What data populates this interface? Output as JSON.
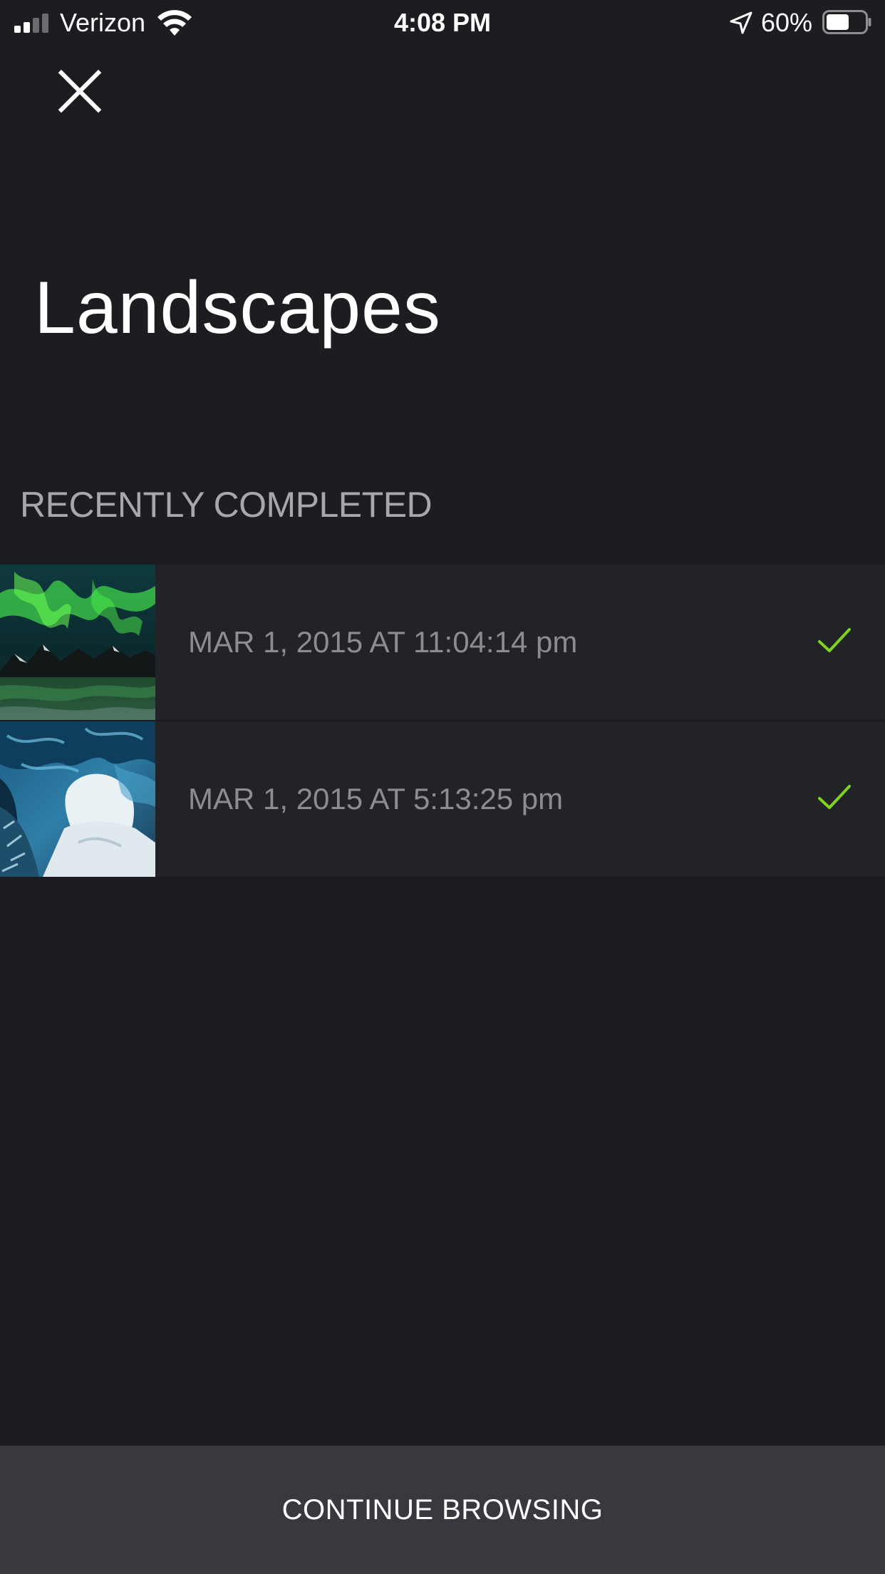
{
  "status_bar": {
    "carrier": "Verizon",
    "time": "4:08 PM",
    "battery_percent": "60%",
    "battery_level": 0.6,
    "signal_bars_filled": 2,
    "signal_bars_total": 4
  },
  "header": {
    "close_icon": "close-icon",
    "title": "Landscapes"
  },
  "recently_completed": {
    "section_title": "RECENTLY COMPLETED",
    "items": [
      {
        "thumbnail": "aurora-landscape-thumbnail",
        "date": "MAR 1, 2015 AT 11:04:14 pm",
        "status_icon": "check-icon"
      },
      {
        "thumbnail": "ice-cave-thumbnail",
        "date": "MAR 1, 2015 AT 5:13:25 pm",
        "status_icon": "check-icon"
      }
    ]
  },
  "footer": {
    "continue_label": "CONTINUE BROWSING"
  },
  "colors": {
    "background": "#1c1d21",
    "list_row": "#222327",
    "footer_button": "#37393e",
    "check_accent": "#7ed321",
    "muted_text": "#8c8d91",
    "section_text": "#a7a8ab"
  }
}
